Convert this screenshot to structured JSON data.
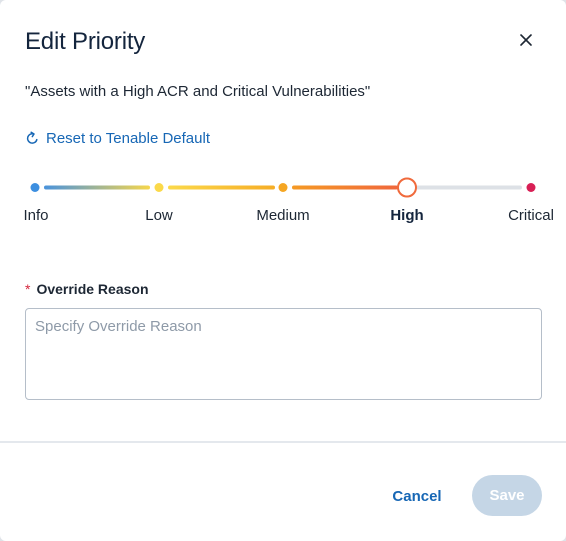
{
  "dialog": {
    "title": "Edit Priority",
    "subtitle": "\"Assets with a High ACR and Critical Vulnerabilities\"",
    "close_icon": "close-icon"
  },
  "reset": {
    "label": "Reset to Tenable Default",
    "icon": "refresh-icon"
  },
  "slider": {
    "levels": [
      {
        "label": "Info",
        "color": "#3d8fe0"
      },
      {
        "label": "Low",
        "color": "#fbd94a"
      },
      {
        "label": "Medium",
        "color": "#f5a623"
      },
      {
        "label": "High",
        "color": "#f06a3c"
      },
      {
        "label": "Critical",
        "color": "#d81f55"
      }
    ],
    "selected": "High",
    "track_inactive_color": "#dde1e6"
  },
  "override": {
    "required_mark": "*",
    "label": "Override Reason",
    "placeholder": "Specify Override Reason",
    "value": ""
  },
  "footer": {
    "cancel_label": "Cancel",
    "save_label": "Save"
  },
  "colors": {
    "accent": "#1767b5",
    "save_disabled": "#c5d6e6"
  }
}
